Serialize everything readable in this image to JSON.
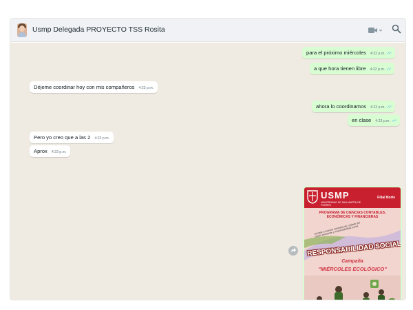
{
  "chat": {
    "contact_name": "Usmp Delegada PROYECTO TSS Rosita",
    "messages": [
      {
        "text": "para el próximo miércoles",
        "time": "4:22 p.m.",
        "direction": "out"
      },
      {
        "text": "a que hora tienen libre",
        "time": "4:22 p.m.",
        "direction": "out"
      },
      {
        "text": "Déjeme coordinar hoy con mis compañeros",
        "time": "4:23 p.m.",
        "direction": "in"
      },
      {
        "text": "ahora lo coordinamos",
        "time": "4:23 p.m.",
        "direction": "out"
      },
      {
        "text": "en clase",
        "time": "4:23 p.m.",
        "direction": "out"
      },
      {
        "text": "Pero yo creo que a las 2",
        "time": "4:23 p.m.",
        "direction": "in"
      },
      {
        "text": "Aprox",
        "time": "4:23 p.m.",
        "direction": "in"
      }
    ],
    "image_message": {
      "logo": "USMP",
      "logo_sub": "UNIVERSIDAD DE SAN MARTÍN DE PORRES",
      "filial": "Filial Norte",
      "programa": "PROGRAMA DE CIENCIAS CONTABLES, ECONÓMICAS Y FINANCIERAS",
      "slogan": "Súmate a nuestra campaña de cuidado del medio ambiente y responsabilidad social",
      "headline": "RESPONSABILIDAD SOCIAL",
      "campana": "Campaña",
      "campaign_name": "\"MIÉRCOLES ECOLÓGICO\""
    }
  },
  "icons": {
    "video": "video-call-icon",
    "search": "search-icon",
    "forward": "forward-icon",
    "ticks": "double-check-icon"
  },
  "colors": {
    "outgoing_bubble": "#d9fdd3",
    "incoming_bubble": "#ffffff",
    "chat_background": "#efeae2",
    "read_ticks": "#53bdeb",
    "usmp_red": "#c8202f"
  }
}
